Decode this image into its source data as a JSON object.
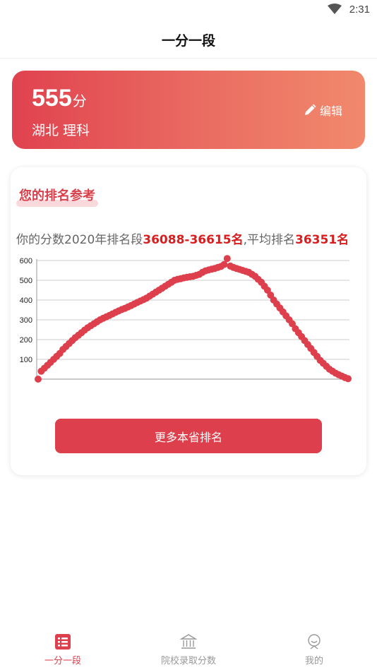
{
  "status_bar": {
    "time": "2:31",
    "wifi_icon": "wifi-icon"
  },
  "header": {
    "title": "一分一段"
  },
  "score_card": {
    "score": "555",
    "unit": "分",
    "region": "湖北 理科",
    "edit_label": "编辑",
    "edit_icon": "pencil-icon"
  },
  "rank_card": {
    "title": "您的排名参考",
    "summary_prefix": "你的分数2020年排名段",
    "rank_range": "36088-36615名",
    "summary_mid": ",平均排名",
    "avg_rank": "36351名",
    "more_button": "更多本省排名"
  },
  "chart_data": {
    "type": "scatter",
    "title": "",
    "xlabel": "",
    "ylabel": "",
    "ylim": [
      0,
      600
    ],
    "y_ticks": [
      "100",
      "200",
      "300",
      "400",
      "500",
      "600"
    ],
    "grid": true,
    "color": "#dd404c",
    "x": [
      0,
      1,
      2,
      3,
      4,
      5,
      6,
      7,
      8,
      9,
      10,
      11,
      12,
      13,
      14,
      15,
      16,
      17,
      18,
      19,
      20,
      21,
      22,
      23,
      24,
      25,
      26,
      27,
      28,
      29,
      30,
      31,
      32,
      33,
      34,
      35,
      36,
      37,
      38,
      39,
      40,
      41,
      42,
      43,
      44,
      45,
      46,
      47,
      48,
      49,
      50,
      51,
      52,
      53,
      54,
      55,
      56,
      57,
      58,
      59,
      60,
      61,
      62,
      63,
      64,
      65,
      66,
      67,
      68,
      69,
      70,
      71,
      72,
      73,
      74,
      75,
      76,
      77,
      78,
      79,
      80,
      81,
      82,
      83,
      84,
      85,
      86,
      87,
      88,
      89,
      90,
      91,
      92,
      93,
      94,
      95,
      96,
      97,
      98,
      99,
      100
    ],
    "y": [
      0,
      40,
      55,
      70,
      85,
      100,
      115,
      130,
      150,
      165,
      180,
      195,
      210,
      222,
      235,
      248,
      260,
      270,
      280,
      290,
      300,
      308,
      315,
      322,
      330,
      338,
      345,
      352,
      358,
      365,
      372,
      380,
      388,
      395,
      402,
      410,
      420,
      430,
      440,
      450,
      460,
      470,
      480,
      490,
      500,
      505,
      508,
      512,
      515,
      518,
      520,
      525,
      530,
      540,
      548,
      552,
      556,
      560,
      565,
      570,
      580,
      610,
      572,
      565,
      560,
      555,
      550,
      545,
      540,
      530,
      520,
      505,
      490,
      470,
      450,
      425,
      400,
      380,
      360,
      340,
      320,
      300,
      280,
      255,
      235,
      215,
      195,
      175,
      155,
      135,
      115,
      95,
      80,
      65,
      50,
      40,
      30,
      22,
      15,
      8,
      2
    ]
  },
  "tab_bar": {
    "tabs": [
      {
        "label": "一分一段",
        "icon": "list-icon",
        "active": true
      },
      {
        "label": "院校录取分数",
        "icon": "university-icon",
        "active": false
      },
      {
        "label": "我的",
        "icon": "user-icon",
        "active": false
      }
    ]
  }
}
